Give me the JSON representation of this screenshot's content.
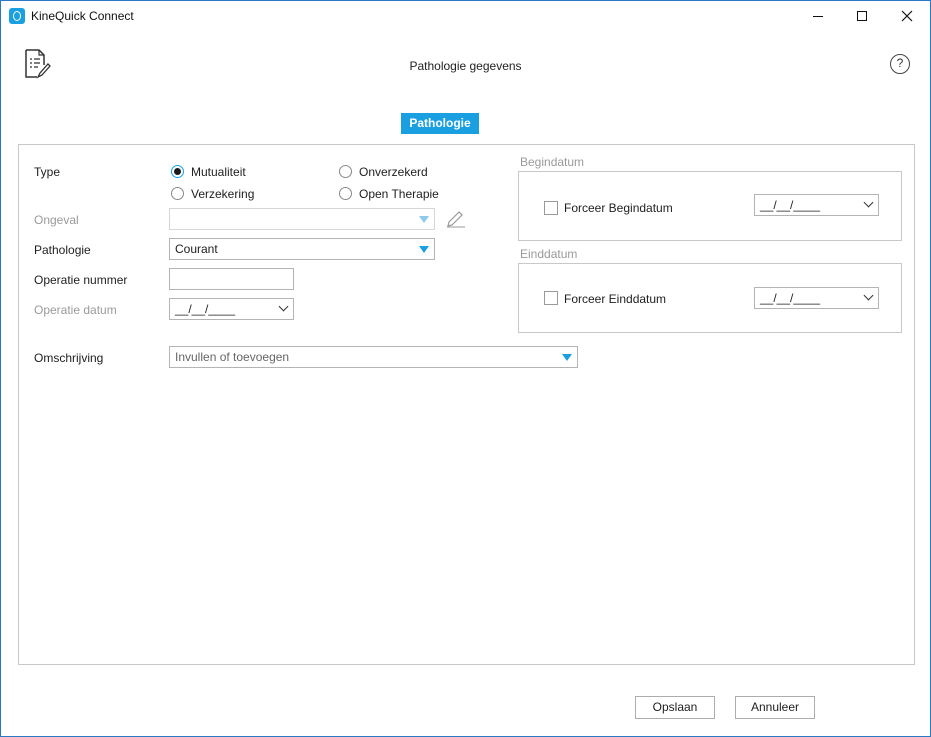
{
  "window": {
    "title": "KineQuick Connect"
  },
  "header": {
    "title": "Pathologie gegevens",
    "help": "?"
  },
  "tabs": [
    {
      "label": "Pathologie",
      "active": true
    }
  ],
  "form": {
    "type_label": "Type",
    "type_options": [
      {
        "label": "Mutualiteit",
        "checked": true
      },
      {
        "label": "Onverzekerd",
        "checked": false
      },
      {
        "label": "Verzekering",
        "checked": false
      },
      {
        "label": "Open Therapie",
        "checked": false
      }
    ],
    "ongeval_label": "Ongeval",
    "ongeval_value": "",
    "pathologie_label": "Pathologie",
    "pathologie_value": "Courant",
    "operatie_nummer_label": "Operatie nummer",
    "operatie_nummer_value": "",
    "operatie_datum_label": "Operatie datum",
    "operatie_datum_value": "__/__/____",
    "omschrijving_label": "Omschrijving",
    "omschrijving_placeholder": "Invullen of toevoegen"
  },
  "begindatum": {
    "group_title": "Begindatum",
    "checkbox_label": "Forceer Begindatum",
    "checked": false,
    "date_value": "__/__/____"
  },
  "einddatum": {
    "group_title": "Einddatum",
    "checkbox_label": "Forceer Einddatum",
    "checked": false,
    "date_value": "__/__/____"
  },
  "footer": {
    "save_label": "Opslaan",
    "cancel_label": "Annuleer"
  },
  "colors": {
    "accent": "#1a9fe0",
    "window_border": "#2b78c5",
    "disabled_text": "#9a9a9a"
  },
  "icons": {
    "app": "kinequick-logo-icon",
    "document": "document-edit-icon",
    "help": "help-circle-icon",
    "edit": "pencil-icon"
  }
}
